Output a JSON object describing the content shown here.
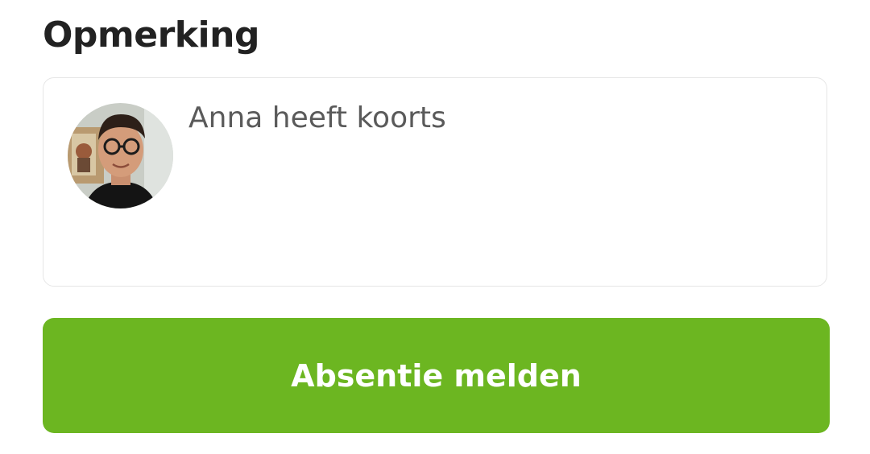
{
  "section": {
    "title": "Opmerking"
  },
  "comment": {
    "text": "Anna heeft koorts"
  },
  "actions": {
    "submit_label": "Absentie melden"
  },
  "colors": {
    "primary_button": "#6cb621",
    "heading_text": "#222222",
    "comment_text": "#5a5a5a",
    "box_border": "#e6e6e6"
  },
  "icons": {
    "avatar": "user-avatar-photo"
  }
}
